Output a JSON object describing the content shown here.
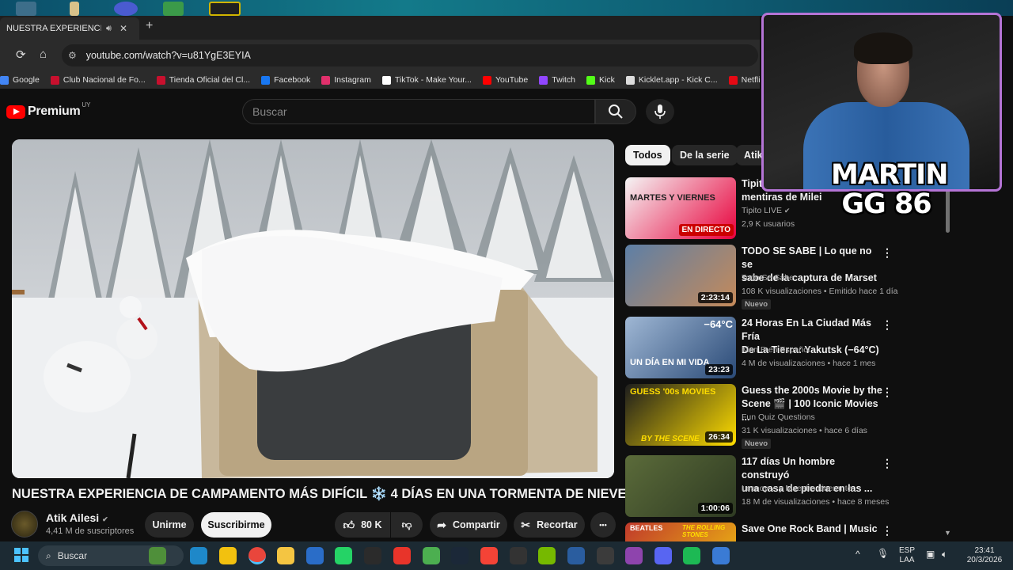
{
  "browser": {
    "tab_title": "NUESTRA EXPERIENCIA DE",
    "tab_audio_icon": "speaker-icon",
    "tab_close": "✕",
    "new_tab": "+",
    "url": "youtube.com/watch?v=u81YgE3EYIA",
    "bookmarks": [
      {
        "label": "Google",
        "color": "#4285f4"
      },
      {
        "label": "Club Nacional de Fo...",
        "color": "#c8102e"
      },
      {
        "label": "Tienda Oficial del Cl...",
        "color": "#c8102e"
      },
      {
        "label": "Facebook",
        "color": "#1877f2"
      },
      {
        "label": "Instagram",
        "color": "#e1306c"
      },
      {
        "label": "TikTok - Make Your...",
        "color": "#ffffff"
      },
      {
        "label": "YouTube",
        "color": "#ff0000"
      },
      {
        "label": "Twitch",
        "color": "#9146ff"
      },
      {
        "label": "Kick",
        "color": "#53fc18"
      },
      {
        "label": "Kicklet.app - Kick C...",
        "color": "#dddddd"
      },
      {
        "label": "Netflix U",
        "color": "#e50914"
      }
    ]
  },
  "youtube": {
    "brand": "Premium",
    "country": "UY",
    "search_placeholder": "Buscar"
  },
  "video": {
    "title": "NUESTRA EXPERIENCIA DE CAMPAMENTO MÁS DIFÍCIL ❄️ 4 DÍAS EN UNA TORMENTA DE NIEVE",
    "channel": "Atik Ailesi",
    "subscribers": "4,41 M de suscriptores",
    "join_label": "Unirme",
    "subscribe_label": "Suscribirme",
    "likes": "80 K",
    "share_label": "Compartir",
    "clip_label": "Recortar",
    "more_label": "•••"
  },
  "chips": [
    "Todos",
    "De la serie",
    "Atik"
  ],
  "recommendations": [
    {
      "title_line1": "Tipit",
      "title_line2": "mentiras de Milei",
      "channel": "Tipito LIVE",
      "verified": true,
      "meta": "2,9 K usuarios",
      "badge": "",
      "duration": "",
      "live": "EN DIRECTO",
      "thumb_text": "MARTES Y VIERNES",
      "colors": [
        "#f5f5f5",
        "#e8003b"
      ]
    },
    {
      "title_line1": "TODO SE SABE | Lo que no se",
      "title_line2": "sabe de la captura de Marset",
      "channel": "Todo Se Sabe",
      "verified": false,
      "meta": "108 K visualizaciones • Emitido hace 1 día",
      "badge": "Nuevo",
      "duration": "2:23:14",
      "live": "",
      "thumb_text": "",
      "colors": [
        "#5d7fa6",
        "#c58a5a"
      ]
    },
    {
      "title_line1": "24 Horas En La Ciudad Más Fría",
      "title_line2": "De La Tierra: Yakutsk (−64°C)",
      "channel": "Kiun B en Español",
      "verified": false,
      "meta": "4 M de visualizaciones • hace 1 mes",
      "badge": "",
      "duration": "23:23",
      "live": "",
      "thumb_text": "UN DÍA EN MI VIDA",
      "thumb_temp": "−64°C",
      "colors": [
        "#9fb7d4",
        "#2a4a77"
      ]
    },
    {
      "title_line1": "Guess the 2000s Movie by the",
      "title_line2": "Scene 🎬 | 100 Iconic Movies ...",
      "channel": "Fun Quiz Questions",
      "verified": false,
      "meta": "31 K visualizaciones • hace 6 días",
      "badge": "Nuevo",
      "duration": "26:34",
      "live": "",
      "thumb_text": "GUESS '00s MOVIES",
      "thumb_text2": "BY THE SCENE",
      "colors": [
        "#1d1d1d",
        "#ffdd00"
      ]
    },
    {
      "title_line1": "117 días Un hombre construyó",
      "title_line2": "una casa de piedra en las ...",
      "channel": "Lesnoy",
      "verified": true,
      "channel_extra": "y Maestro itinerante",
      "meta": "18 M de visualizaciones • hace 8 meses",
      "badge": "",
      "duration": "1:00:06",
      "live": "",
      "thumb_text": "",
      "colors": [
        "#5b6b3a",
        "#2e3a22"
      ]
    },
    {
      "title_line1": "Save One Rock Band | Music",
      "title_line2": "",
      "channel": "",
      "verified": false,
      "meta": "",
      "badge": "",
      "duration": "",
      "live": "",
      "thumb_text": "BEATLES",
      "thumb_text2": "THE ROLLING STONES",
      "colors": [
        "#c0392b",
        "#f1c40f"
      ]
    }
  ],
  "webcam": {
    "name_line1": "MARTIN",
    "name_line2": "GG 86",
    "border_color": "#b574d6"
  },
  "taskbar": {
    "search_placeholder": "Buscar",
    "language": "ESP",
    "keyboard": "LAA",
    "time": "23:41",
    "date": "20/3/2026"
  }
}
